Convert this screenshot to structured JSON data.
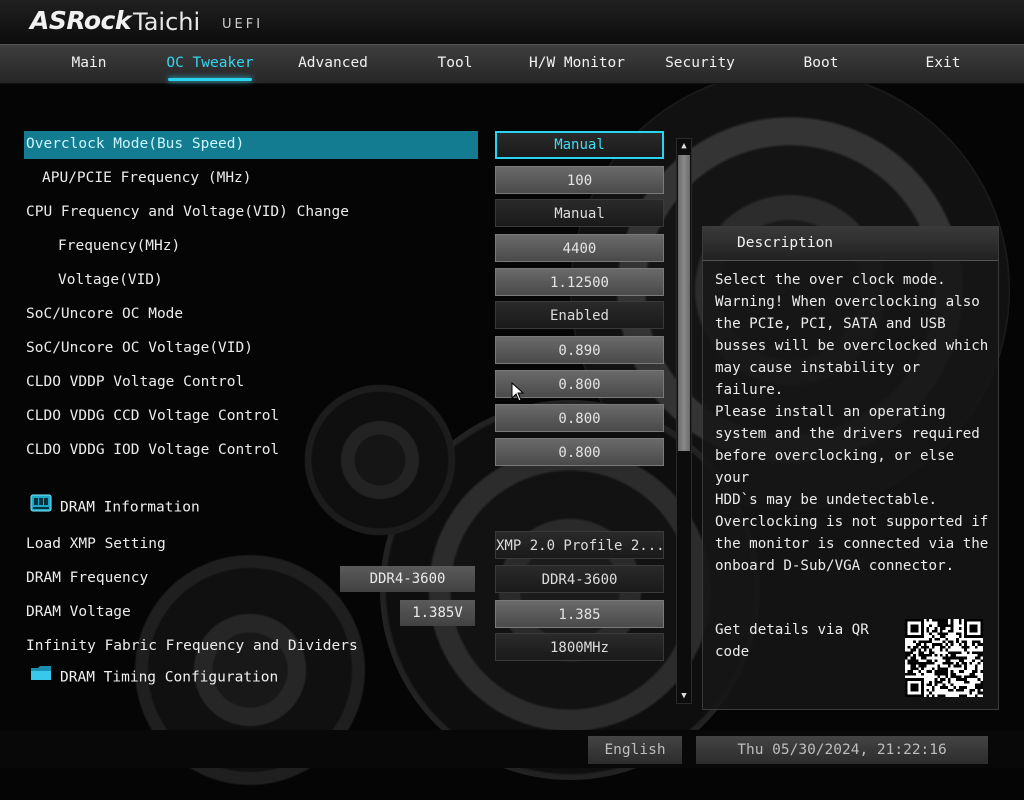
{
  "brand": {
    "logo": "ASRock",
    "model": "Taichi",
    "firmware": "UEFI"
  },
  "tabs": [
    {
      "label": "Main",
      "active": false
    },
    {
      "label": "OC Tweaker",
      "active": true
    },
    {
      "label": "Advanced",
      "active": false
    },
    {
      "label": "Tool",
      "active": false
    },
    {
      "label": "H/W Monitor",
      "active": false
    },
    {
      "label": "Security",
      "active": false
    },
    {
      "label": "Boot",
      "active": false
    },
    {
      "label": "Exit",
      "active": false
    }
  ],
  "settings": [
    {
      "label": "Overclock Mode(Bus Speed)",
      "value": "Manual",
      "selected": true
    },
    {
      "label": "APU/PCIE Frequency (MHz)",
      "value": "100"
    },
    {
      "label": "CPU Frequency and Voltage(VID) Change",
      "value": "Manual"
    },
    {
      "label": "Frequency(MHz)",
      "value": "4400"
    },
    {
      "label": "Voltage(VID)",
      "value": "1.12500"
    },
    {
      "label": "SoC/Uncore OC Mode",
      "value": "Enabled"
    },
    {
      "label": "SoC/Uncore OC Voltage(VID)",
      "value": "0.890"
    },
    {
      "label": "CLDO VDDP Voltage Control",
      "value": "0.800"
    },
    {
      "label": "CLDO VDDG CCD Voltage Control",
      "value": "0.800"
    },
    {
      "label": "CLDO VDDG IOD Voltage Control",
      "value": "0.800"
    }
  ],
  "dram_section": {
    "label": "DRAM Information",
    "icon": "memory-module-icon"
  },
  "dram_settings": [
    {
      "label": "Load XMP Setting",
      "value": "XMP 2.0 Profile 2..."
    },
    {
      "label": "DRAM Frequency",
      "current": "DDR4-3600",
      "value": "DDR4-3600"
    },
    {
      "label": "DRAM Voltage",
      "current": "1.385V",
      "value": "1.385"
    },
    {
      "label": "Infinity Fabric Frequency and Dividers",
      "value": "1800MHz"
    }
  ],
  "timing_section": {
    "label": "DRAM Timing Configuration",
    "icon": "folder-icon"
  },
  "description": {
    "title": "Description",
    "text": "Select the over clock mode.\nWarning! When overclocking also\nthe PCIe, PCI, SATA and USB\nbusses will be overclocked which\nmay cause instability or failure.\nPlease install an operating\nsystem and the drivers required\nbefore overclocking, or else your\nHDD`s may be undetectable.\nOverclocking is not supported if\nthe monitor is connected via the\nonboard D-Sub/VGA connector.",
    "qr_label": "Get details via QR code"
  },
  "footer": {
    "language": "English",
    "datetime": "Thu 05/30/2024, 21:22:16"
  },
  "colors": {
    "accent": "#2ad3ef",
    "selected_row": "#147c90",
    "background": "#050505"
  }
}
